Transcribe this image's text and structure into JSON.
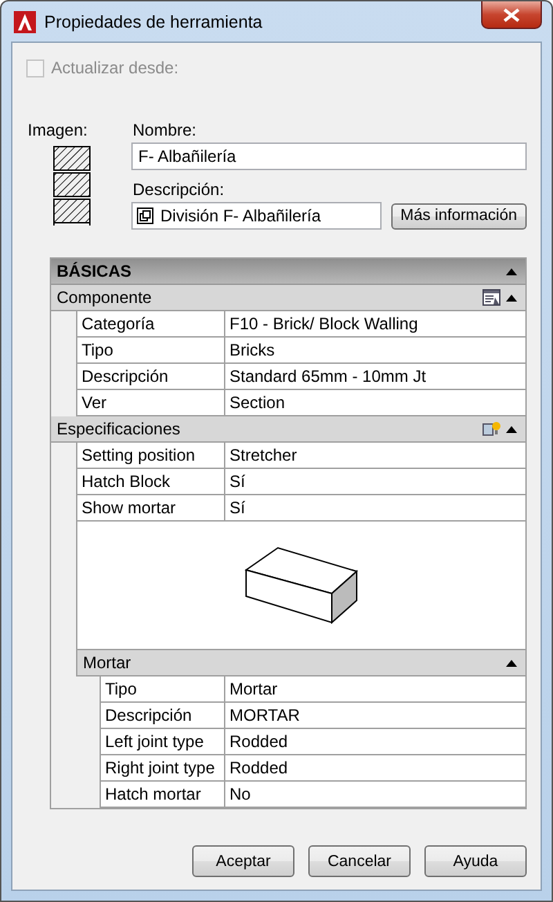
{
  "window": {
    "title": "Propiedades de herramienta"
  },
  "update_from": {
    "label": "Actualizar desde:",
    "checked": false,
    "disabled": true
  },
  "image_label": "Imagen:",
  "name_field": {
    "label": "Nombre:",
    "value": "F- Albañilería"
  },
  "description_field": {
    "label": "Descripción:",
    "value": "División F- Albañilería"
  },
  "more_info_button": "Más información",
  "property_grid": {
    "title": "BÁSICAS",
    "expanded": true,
    "sections": [
      {
        "name": "Componente",
        "kind": "component",
        "expanded": true,
        "rows": [
          {
            "name": "Categoría",
            "value": "F10 - Brick/ Block Walling"
          },
          {
            "name": "Tipo",
            "value": "Bricks"
          },
          {
            "name": "Descripción",
            "value": "Standard 65mm - 10mm Jt"
          },
          {
            "name": "Ver",
            "value": "Section"
          }
        ]
      },
      {
        "name": "Especificaciones",
        "kind": "specification",
        "expanded": true,
        "rows": [
          {
            "name": "Setting position",
            "value": "Stretcher"
          },
          {
            "name": "Hatch Block",
            "value": "Sí"
          },
          {
            "name": "Show mortar",
            "value": "Sí"
          }
        ],
        "subsections": [
          {
            "name": "Mortar",
            "expanded": true,
            "rows": [
              {
                "name": "Tipo",
                "value": "Mortar"
              },
              {
                "name": "Descripción",
                "value": "MORTAR"
              },
              {
                "name": "Left joint type",
                "value": "Rodded"
              },
              {
                "name": "Right joint type",
                "value": "Rodded"
              },
              {
                "name": "Hatch mortar",
                "value": "No"
              }
            ]
          }
        ]
      }
    ]
  },
  "buttons": [
    "Aceptar",
    "Cancelar",
    "Ayuda"
  ]
}
